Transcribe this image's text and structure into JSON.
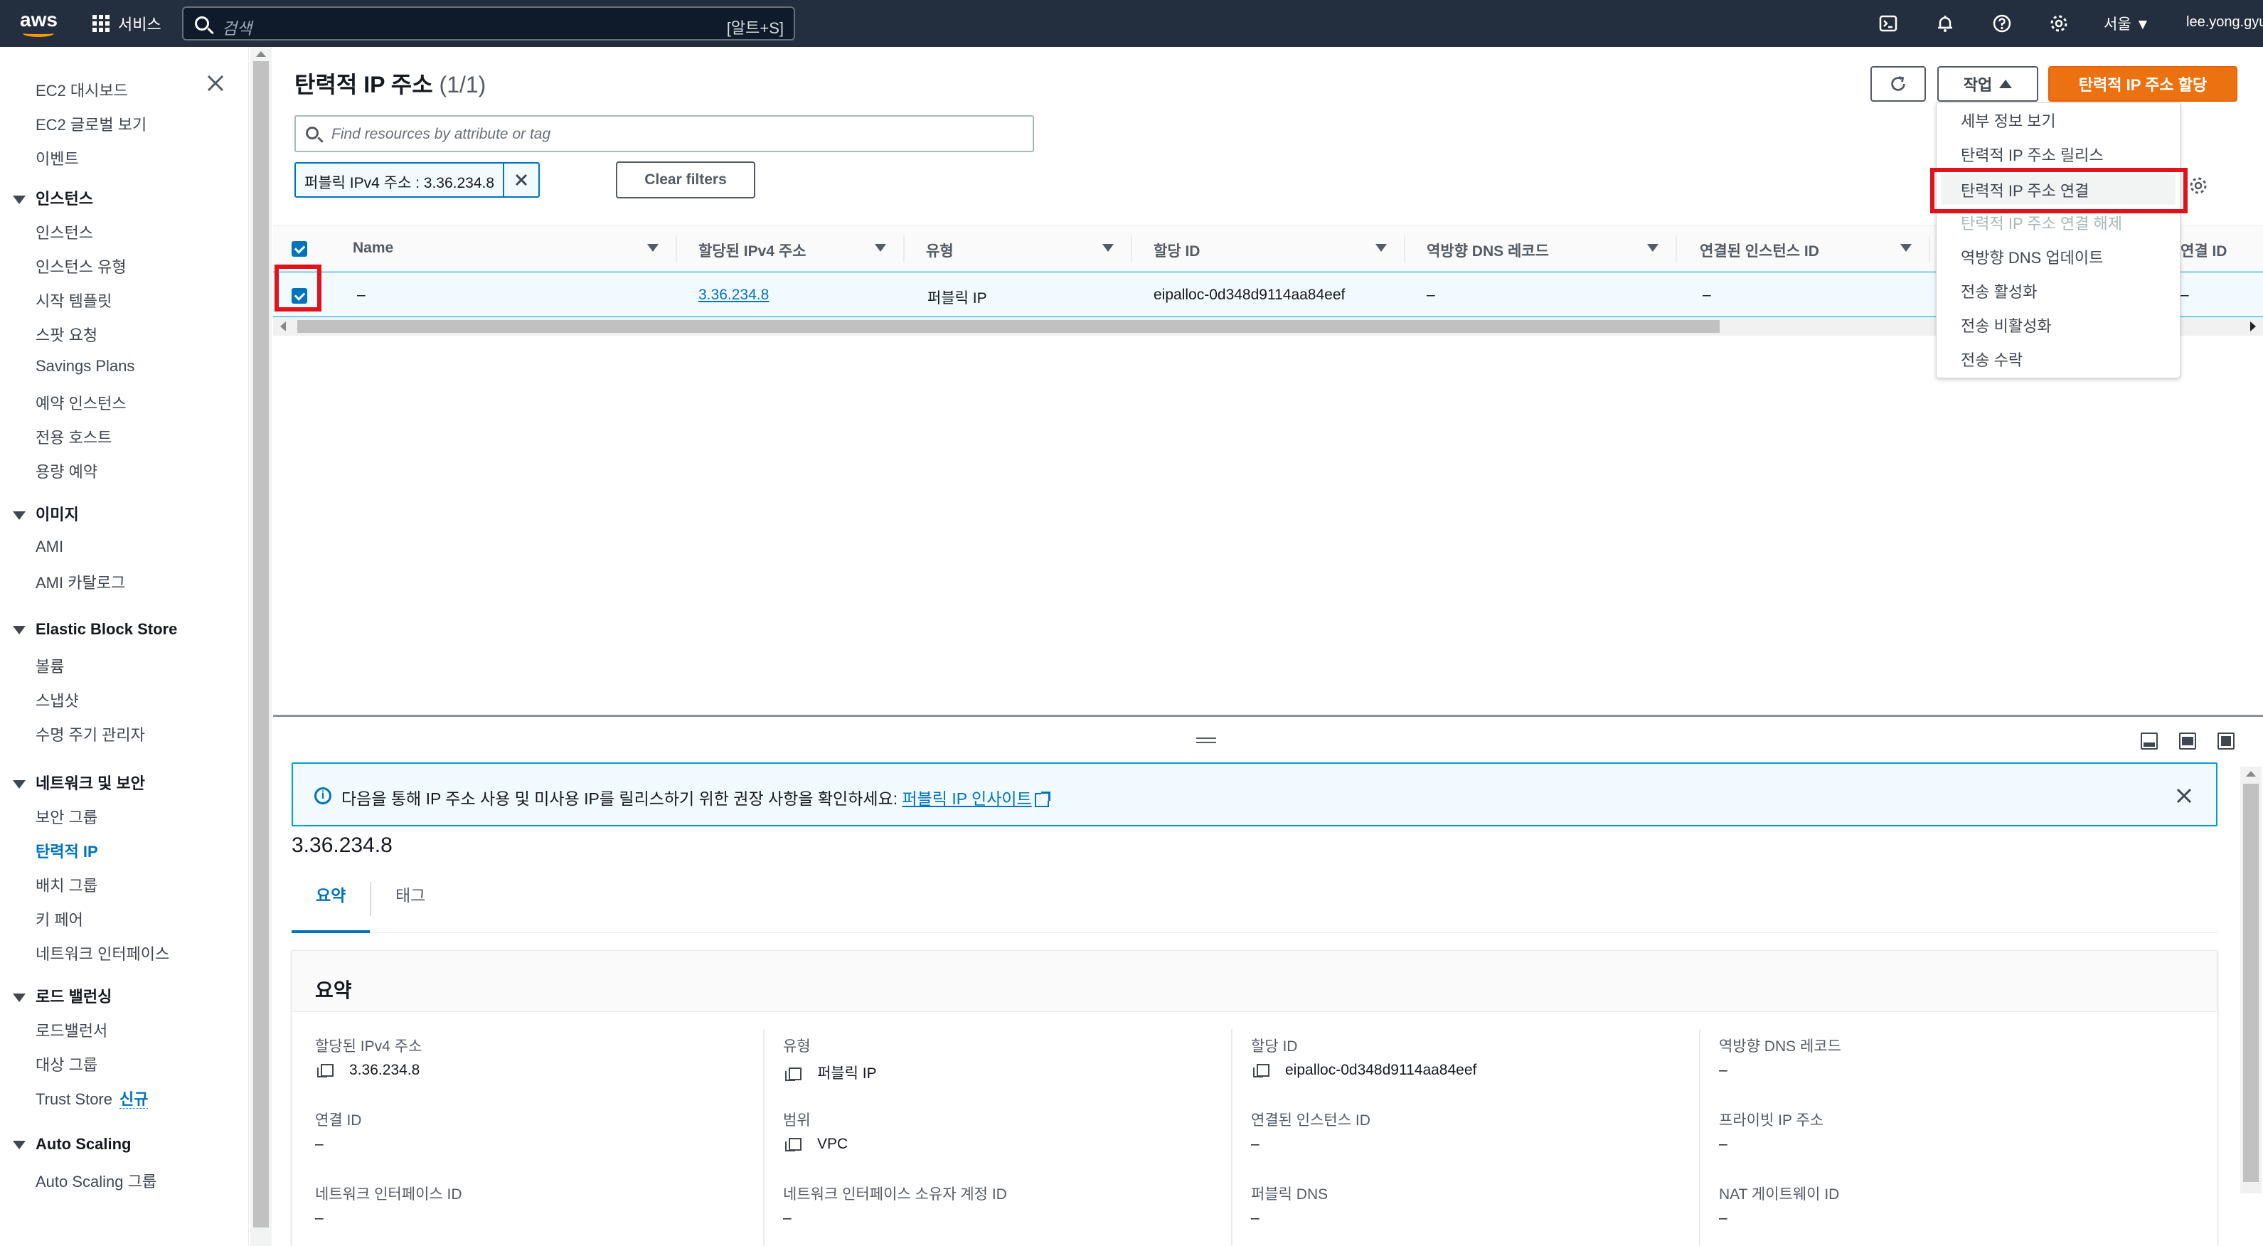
{
  "topnav": {
    "logo": "aws",
    "services_label": "서비스",
    "search_placeholder": "검색",
    "search_shortcut": "[알트+S]",
    "region": "서울 ▼",
    "user": "lee.yong.gyu"
  },
  "sidebar": {
    "top_items": [
      "EC2 대시보드",
      "EC2 글로벌 보기",
      "이벤트"
    ],
    "sections": [
      {
        "title": "인스턴스",
        "items": [
          "인스턴스",
          "인스턴스 유형",
          "시작 템플릿",
          "스팟 요청",
          "Savings Plans",
          "예약 인스턴스",
          "전용 호스트",
          "용량 예약"
        ]
      },
      {
        "title": "이미지",
        "items": [
          "AMI",
          "AMI 카탈로그"
        ]
      },
      {
        "title": "Elastic Block Store",
        "items": [
          "볼륨",
          "스냅샷",
          "수명 주기 관리자"
        ]
      },
      {
        "title": "네트워크 및 보안",
        "items": [
          "보안 그룹",
          "탄력적 IP",
          "배치 그룹",
          "키 페어",
          "네트워크 인터페이스"
        ]
      },
      {
        "title": "로드 밸런싱",
        "items": [
          "로드밸런서",
          "대상 그룹",
          "Trust Store"
        ]
      },
      {
        "title": "Auto Scaling",
        "items": [
          "Auto Scaling 그룹"
        ]
      }
    ],
    "new_badge": "신규",
    "active_item": "탄력적 IP"
  },
  "main": {
    "title": "탄력적 IP 주소",
    "count": "(1/1)",
    "actions_label": "작업",
    "allocate_label": "탄력적 IP 주소 할당",
    "filter_placeholder": "Find resources by attribute or tag",
    "filter_token": "퍼블릭 IPv4 주소 : 3.36.234.8",
    "clear_filters": "Clear filters"
  },
  "table": {
    "columns": [
      "Name",
      "할당된 IPv4 주소",
      "유형",
      "할당 ID",
      "역방향 DNS 레코드",
      "연결된 인스턴스 ID",
      "연결 ID"
    ],
    "rows": [
      {
        "name": "–",
        "ipv4": "3.36.234.8",
        "type": "퍼블릭 IP",
        "alloc_id": "eipalloc-0d348d9114aa84eef",
        "reverse_dns": "–",
        "instance_id": "–",
        "assoc_id": "–"
      }
    ]
  },
  "actions_menu": {
    "items": [
      {
        "label": "세부 정보 보기",
        "state": "normal"
      },
      {
        "label": "탄력적 IP 주소 릴리스",
        "state": "normal"
      },
      {
        "label": "탄력적 IP 주소 연결",
        "state": "highlighted"
      },
      {
        "label": "탄력적 IP 주소 연결 해제",
        "state": "disabled"
      },
      {
        "label": "역방향 DNS 업데이트",
        "state": "normal"
      },
      {
        "label": "전송 활성화",
        "state": "normal"
      },
      {
        "label": "전송 비활성화",
        "state": "normal"
      },
      {
        "label": "전송 수락",
        "state": "normal"
      }
    ]
  },
  "details": {
    "alert_text": "다음을 통해 IP 주소 사용 및 미사용 IP를 릴리스하기 위한 권장 사항을 확인하세요:",
    "alert_link": "퍼블릭 IP 인사이트",
    "ip_title": "3.36.234.8",
    "tabs": [
      "요약",
      "태그"
    ],
    "summary_title": "요약",
    "fields": [
      {
        "label": "할당된 IPv4 주소",
        "value": "3.36.234.8",
        "copy": true
      },
      {
        "label": "유형",
        "value": "퍼블릭 IP",
        "copy": true
      },
      {
        "label": "할당 ID",
        "value": "eipalloc-0d348d9114aa84eef",
        "copy": true
      },
      {
        "label": "역방향 DNS 레코드",
        "value": "–",
        "copy": false
      },
      {
        "label": "연결 ID",
        "value": "–",
        "copy": false
      },
      {
        "label": "범위",
        "value": "VPC",
        "copy": true
      },
      {
        "label": "연결된 인스턴스 ID",
        "value": "–",
        "copy": false
      },
      {
        "label": "프라이빗 IP 주소",
        "value": "–",
        "copy": false
      },
      {
        "label": "네트워크 인터페이스 ID",
        "value": "–",
        "copy": false
      },
      {
        "label": "네트워크 인터페이스 소유자 계정 ID",
        "value": "–",
        "copy": false
      },
      {
        "label": "퍼블릭 DNS",
        "value": "–",
        "copy": false
      },
      {
        "label": "NAT 게이트웨이 ID",
        "value": "–",
        "copy": false
      }
    ]
  },
  "colors": {
    "nav_bg": "#232f3e",
    "accent_orange": "#ec7211",
    "link_blue": "#0073bb",
    "highlight_red": "#e0121b"
  }
}
